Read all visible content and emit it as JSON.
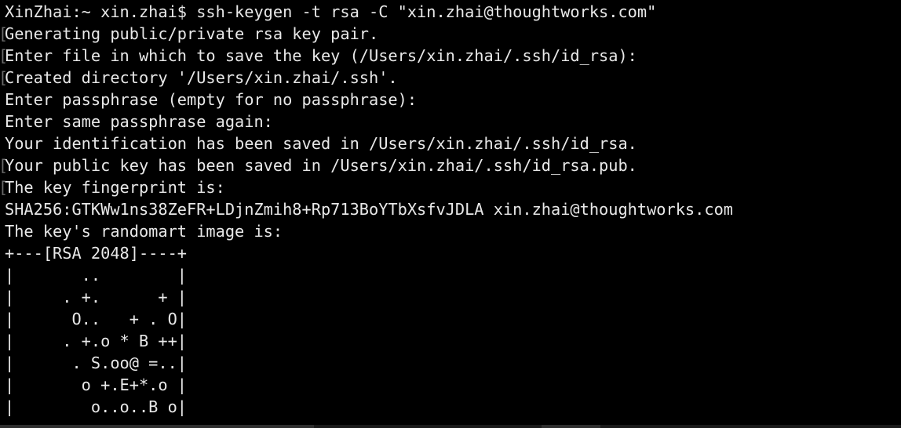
{
  "terminal": {
    "lines": [
      "XinZhai:~ xin.zhai$ ssh-keygen -t rsa -C \"xin.zhai@thoughtworks.com\"",
      "Generating public/private rsa key pair.",
      "Enter file in which to save the key (/Users/xin.zhai/.ssh/id_rsa):",
      "Created directory '/Users/xin.zhai/.ssh'.",
      "Enter passphrase (empty for no passphrase):",
      "Enter same passphrase again:",
      "Your identification has been saved in /Users/xin.zhai/.ssh/id_rsa.",
      "Your public key has been saved in /Users/xin.zhai/.ssh/id_rsa.pub.",
      "The key fingerprint is:",
      "SHA256:GTKWw1ns38ZeFR+LDjnZmih8+Rp713BoYTbXsfvJDLA xin.zhai@thoughtworks.com",
      "The key's randomart image is:",
      "+---[RSA 2048]----+",
      "|       ..        |",
      "|     . +.      + |",
      "|      O..   + . O|",
      "|     . +.o * B ++|",
      "|      . S.oo@ =..|",
      "|       o +.E+*.o |",
      "|        o..o..B o|"
    ]
  },
  "colors": {
    "background": "#000000",
    "foreground": "#e8e8e8",
    "marker": "#6a6a6a"
  }
}
